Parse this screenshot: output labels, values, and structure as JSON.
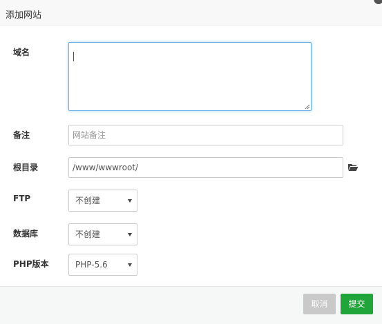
{
  "dialog": {
    "title": "添加网站"
  },
  "form": {
    "domain": {
      "label": "域名",
      "value": ""
    },
    "note": {
      "label": "备注",
      "placeholder": "网站备注"
    },
    "root": {
      "label": "根目录",
      "value": "/www/wwwroot/"
    },
    "ftp": {
      "label": "FTP",
      "selected": "不创建"
    },
    "database": {
      "label": "数据库",
      "selected": "不创建"
    },
    "php": {
      "label": "PHP版本",
      "selected": "PHP-5.6"
    }
  },
  "footer": {
    "cancel_label": "取消",
    "submit_label": "提交"
  },
  "colors": {
    "submit": "#20a53a",
    "cancel": "#c9c9c9",
    "focus_border": "#66afe9"
  },
  "icons": {
    "close": "close-icon",
    "folder": "folder-open-icon",
    "dropdown": "chevron-down-icon"
  }
}
